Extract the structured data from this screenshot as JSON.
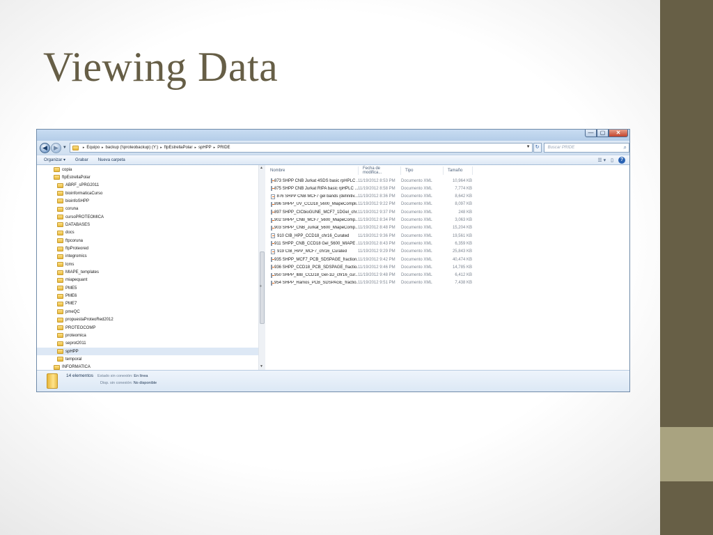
{
  "slide": {
    "title": "Viewing Data"
  },
  "window": {
    "controls": {
      "minimize": "—",
      "maximize": "▢",
      "close": "✕"
    },
    "nav": {
      "back_glyph": "◀",
      "forward_glyph": "▶",
      "dropdown_glyph": "▼"
    },
    "breadcrumb": [
      "Equipo",
      "backup (\\\\proteobackup) (Y:)",
      "ftpEstrellaPolar",
      "spHPP",
      "PRIDE"
    ],
    "breadcrumb_separator": "▸",
    "refresh_glyph": "↻",
    "search_placeholder": "Buscar PRIDE",
    "toolbar": {
      "organize": "Organizar ▾",
      "burn": "Grabar",
      "new_folder": "Nueva carpeta",
      "view_glyph": "☰ ▾",
      "preview_glyph": "▯",
      "help_glyph": "?"
    },
    "tree": [
      {
        "label": "copia",
        "level": 1
      },
      {
        "label": "ftpEstrellaPolar",
        "level": 1
      },
      {
        "label": "ABRF_sPRG2011",
        "level": 2
      },
      {
        "label": "bioinformaticaCurso",
        "level": 2
      },
      {
        "label": "bioinfoSHPP",
        "level": 2
      },
      {
        "label": "coruna",
        "level": 2
      },
      {
        "label": "cursoPROTEOMICA",
        "level": 2
      },
      {
        "label": "DATABASES",
        "level": 2
      },
      {
        "label": "docs",
        "level": 2
      },
      {
        "label": "ftpcoruna",
        "level": 2
      },
      {
        "label": "ftpProteored",
        "level": 2
      },
      {
        "label": "integromics",
        "level": 2
      },
      {
        "label": "lcms",
        "level": 2
      },
      {
        "label": "MIAPE_templates",
        "level": 2
      },
      {
        "label": "miapequant",
        "level": 2
      },
      {
        "label": "PME5",
        "level": 2
      },
      {
        "label": "PME6",
        "level": 2
      },
      {
        "label": "PME7",
        "level": 2
      },
      {
        "label": "pmeQC",
        "level": 2
      },
      {
        "label": "propuestaProteoRed2012",
        "level": 2
      },
      {
        "label": "PROTEOCOMP",
        "level": 2
      },
      {
        "label": "proteomica",
        "level": 2
      },
      {
        "label": "seprot2011",
        "level": 2
      },
      {
        "label": "spHPP",
        "level": 2,
        "selected": true
      },
      {
        "label": "temporal",
        "level": 2
      },
      {
        "label": "INFORMATICA",
        "level": 1
      }
    ],
    "columns": {
      "name": "Nombre",
      "date": "Fecha de modifica...",
      "type": "Tipo",
      "size": "Tamaño"
    },
    "files": [
      {
        "name": "873 SHPP CNB Jurkat 4SDS basic rpHPLC ...",
        "date": "11/19/2012 8:53 PM",
        "type": "Documento XML",
        "size": "10,964 KB"
      },
      {
        "name": "875 SHPP CNB Jurkat RIPA basic rpHPLC ...",
        "date": "11/19/2012 8:58 PM",
        "type": "Documento XML",
        "size": "7,774 KB"
      },
      {
        "name": "876 SHPP CNB MCF7 gel bands (definitiv...",
        "date": "11/19/2012 8:36 PM",
        "type": "Documento XML",
        "size": "8,642 KB"
      },
      {
        "name": "896 SHPP_UV_CCD18_5600_MiapeCompli...",
        "date": "11/19/2012 9:22 PM",
        "type": "Documento XML",
        "size": "8,097 KB"
      },
      {
        "name": "897 SHPP_CICbioGUNE_MCF7_1DGel_chr...",
        "date": "11/19/2012 9:37 PM",
        "type": "Documento XML",
        "size": "248 KB"
      },
      {
        "name": "902 SHPP_CNB_MCF7_5600_MiapeComp...",
        "date": "11/19/2012 8:34 PM",
        "type": "Documento XML",
        "size": "3,063 KB"
      },
      {
        "name": "903 SHPP_CNB_Jurkat_5600_MiapeComp...",
        "date": "11/19/2012 8:48 PM",
        "type": "Documento XML",
        "size": "15,204 KB"
      },
      {
        "name": "910 CIB_HPP_CCD18_chr16_Curated",
        "date": "11/19/2012 9:36 PM",
        "type": "Documento XML",
        "size": "19,561 KB"
      },
      {
        "name": "911 SHPP_CNB_CCD18 Gel_5600_MIAPE ...",
        "date": "11/19/2012 8:43 PM",
        "type": "Documento XML",
        "size": "6,359 KB"
      },
      {
        "name": "919 CIB_HPP_MCF7_chr16_Curated",
        "date": "11/19/2012 9:29 PM",
        "type": "Documento XML",
        "size": "25,843 KB"
      },
      {
        "name": "935 SHPP_MCF7_PCB_SDSPAGE_fraction...",
        "date": "11/19/2012 9:42 PM",
        "type": "Documento XML",
        "size": "40,474 KB"
      },
      {
        "name": "936 SHPP_CCD18_PCB_SDSPAGE_fractio...",
        "date": "11/19/2012 9:46 PM",
        "type": "Documento XML",
        "size": "14,785 KB"
      },
      {
        "name": "950 SHPP_IBB_CCD18_Gel-1D_chr16_cur...",
        "date": "11/19/2012 9:48 PM",
        "type": "Documento XML",
        "size": "6,412 KB"
      },
      {
        "name": "954 SHPP_Ramos_PCB_SDSPAGE_fractio...",
        "date": "11/19/2012 9:51 PM",
        "type": "Documento XML",
        "size": "7,438 KB"
      }
    ],
    "status": {
      "count": "14 elementos",
      "state_label": "Estado sin conexión:",
      "state_value": "En línea",
      "avail_label": "Disp. sin conexión:",
      "avail_value": "No disponible"
    },
    "scroll_glyphs": {
      "up": "▲",
      "grip": "≡",
      "down": "▼"
    }
  }
}
